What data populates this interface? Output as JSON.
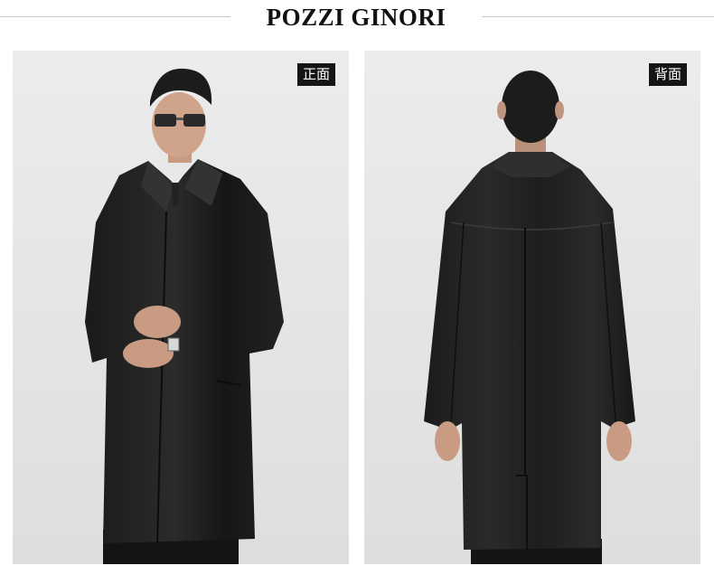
{
  "brand": {
    "name": "POZZI GINORI"
  },
  "panels": [
    {
      "tag": "正面"
    },
    {
      "tag": "背面"
    }
  ]
}
